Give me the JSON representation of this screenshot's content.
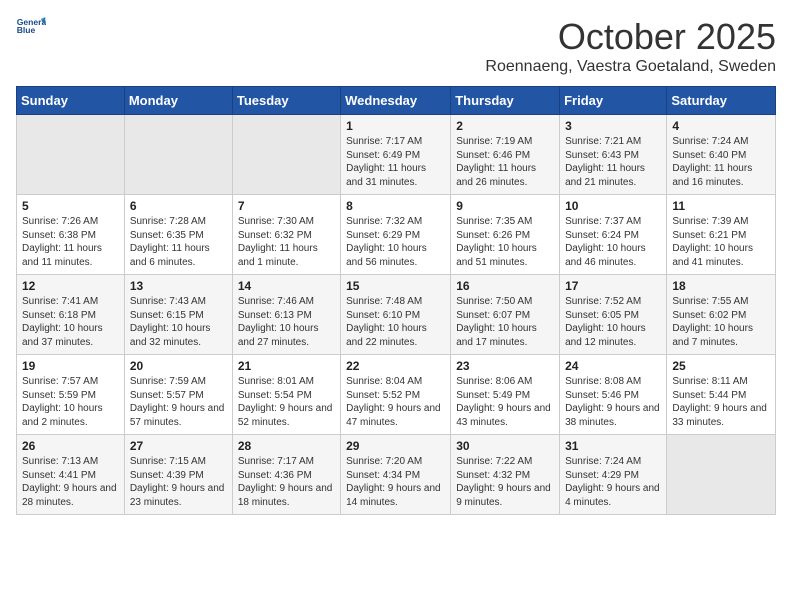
{
  "logo": {
    "line1": "General",
    "line2": "Blue"
  },
  "title": "October 2025",
  "location": "Roennaeng, Vaestra Goetaland, Sweden",
  "days_of_week": [
    "Sunday",
    "Monday",
    "Tuesday",
    "Wednesday",
    "Thursday",
    "Friday",
    "Saturday"
  ],
  "weeks": [
    [
      {
        "day": "",
        "content": ""
      },
      {
        "day": "",
        "content": ""
      },
      {
        "day": "",
        "content": ""
      },
      {
        "day": "1",
        "content": "Sunrise: 7:17 AM\nSunset: 6:49 PM\nDaylight: 11 hours and 31 minutes."
      },
      {
        "day": "2",
        "content": "Sunrise: 7:19 AM\nSunset: 6:46 PM\nDaylight: 11 hours and 26 minutes."
      },
      {
        "day": "3",
        "content": "Sunrise: 7:21 AM\nSunset: 6:43 PM\nDaylight: 11 hours and 21 minutes."
      },
      {
        "day": "4",
        "content": "Sunrise: 7:24 AM\nSunset: 6:40 PM\nDaylight: 11 hours and 16 minutes."
      }
    ],
    [
      {
        "day": "5",
        "content": "Sunrise: 7:26 AM\nSunset: 6:38 PM\nDaylight: 11 hours and 11 minutes."
      },
      {
        "day": "6",
        "content": "Sunrise: 7:28 AM\nSunset: 6:35 PM\nDaylight: 11 hours and 6 minutes."
      },
      {
        "day": "7",
        "content": "Sunrise: 7:30 AM\nSunset: 6:32 PM\nDaylight: 11 hours and 1 minute."
      },
      {
        "day": "8",
        "content": "Sunrise: 7:32 AM\nSunset: 6:29 PM\nDaylight: 10 hours and 56 minutes."
      },
      {
        "day": "9",
        "content": "Sunrise: 7:35 AM\nSunset: 6:26 PM\nDaylight: 10 hours and 51 minutes."
      },
      {
        "day": "10",
        "content": "Sunrise: 7:37 AM\nSunset: 6:24 PM\nDaylight: 10 hours and 46 minutes."
      },
      {
        "day": "11",
        "content": "Sunrise: 7:39 AM\nSunset: 6:21 PM\nDaylight: 10 hours and 41 minutes."
      }
    ],
    [
      {
        "day": "12",
        "content": "Sunrise: 7:41 AM\nSunset: 6:18 PM\nDaylight: 10 hours and 37 minutes."
      },
      {
        "day": "13",
        "content": "Sunrise: 7:43 AM\nSunset: 6:15 PM\nDaylight: 10 hours and 32 minutes."
      },
      {
        "day": "14",
        "content": "Sunrise: 7:46 AM\nSunset: 6:13 PM\nDaylight: 10 hours and 27 minutes."
      },
      {
        "day": "15",
        "content": "Sunrise: 7:48 AM\nSunset: 6:10 PM\nDaylight: 10 hours and 22 minutes."
      },
      {
        "day": "16",
        "content": "Sunrise: 7:50 AM\nSunset: 6:07 PM\nDaylight: 10 hours and 17 minutes."
      },
      {
        "day": "17",
        "content": "Sunrise: 7:52 AM\nSunset: 6:05 PM\nDaylight: 10 hours and 12 minutes."
      },
      {
        "day": "18",
        "content": "Sunrise: 7:55 AM\nSunset: 6:02 PM\nDaylight: 10 hours and 7 minutes."
      }
    ],
    [
      {
        "day": "19",
        "content": "Sunrise: 7:57 AM\nSunset: 5:59 PM\nDaylight: 10 hours and 2 minutes."
      },
      {
        "day": "20",
        "content": "Sunrise: 7:59 AM\nSunset: 5:57 PM\nDaylight: 9 hours and 57 minutes."
      },
      {
        "day": "21",
        "content": "Sunrise: 8:01 AM\nSunset: 5:54 PM\nDaylight: 9 hours and 52 minutes."
      },
      {
        "day": "22",
        "content": "Sunrise: 8:04 AM\nSunset: 5:52 PM\nDaylight: 9 hours and 47 minutes."
      },
      {
        "day": "23",
        "content": "Sunrise: 8:06 AM\nSunset: 5:49 PM\nDaylight: 9 hours and 43 minutes."
      },
      {
        "day": "24",
        "content": "Sunrise: 8:08 AM\nSunset: 5:46 PM\nDaylight: 9 hours and 38 minutes."
      },
      {
        "day": "25",
        "content": "Sunrise: 8:11 AM\nSunset: 5:44 PM\nDaylight: 9 hours and 33 minutes."
      }
    ],
    [
      {
        "day": "26",
        "content": "Sunrise: 7:13 AM\nSunset: 4:41 PM\nDaylight: 9 hours and 28 minutes."
      },
      {
        "day": "27",
        "content": "Sunrise: 7:15 AM\nSunset: 4:39 PM\nDaylight: 9 hours and 23 minutes."
      },
      {
        "day": "28",
        "content": "Sunrise: 7:17 AM\nSunset: 4:36 PM\nDaylight: 9 hours and 18 minutes."
      },
      {
        "day": "29",
        "content": "Sunrise: 7:20 AM\nSunset: 4:34 PM\nDaylight: 9 hours and 14 minutes."
      },
      {
        "day": "30",
        "content": "Sunrise: 7:22 AM\nSunset: 4:32 PM\nDaylight: 9 hours and 9 minutes."
      },
      {
        "day": "31",
        "content": "Sunrise: 7:24 AM\nSunset: 4:29 PM\nDaylight: 9 hours and 4 minutes."
      },
      {
        "day": "",
        "content": ""
      }
    ]
  ]
}
